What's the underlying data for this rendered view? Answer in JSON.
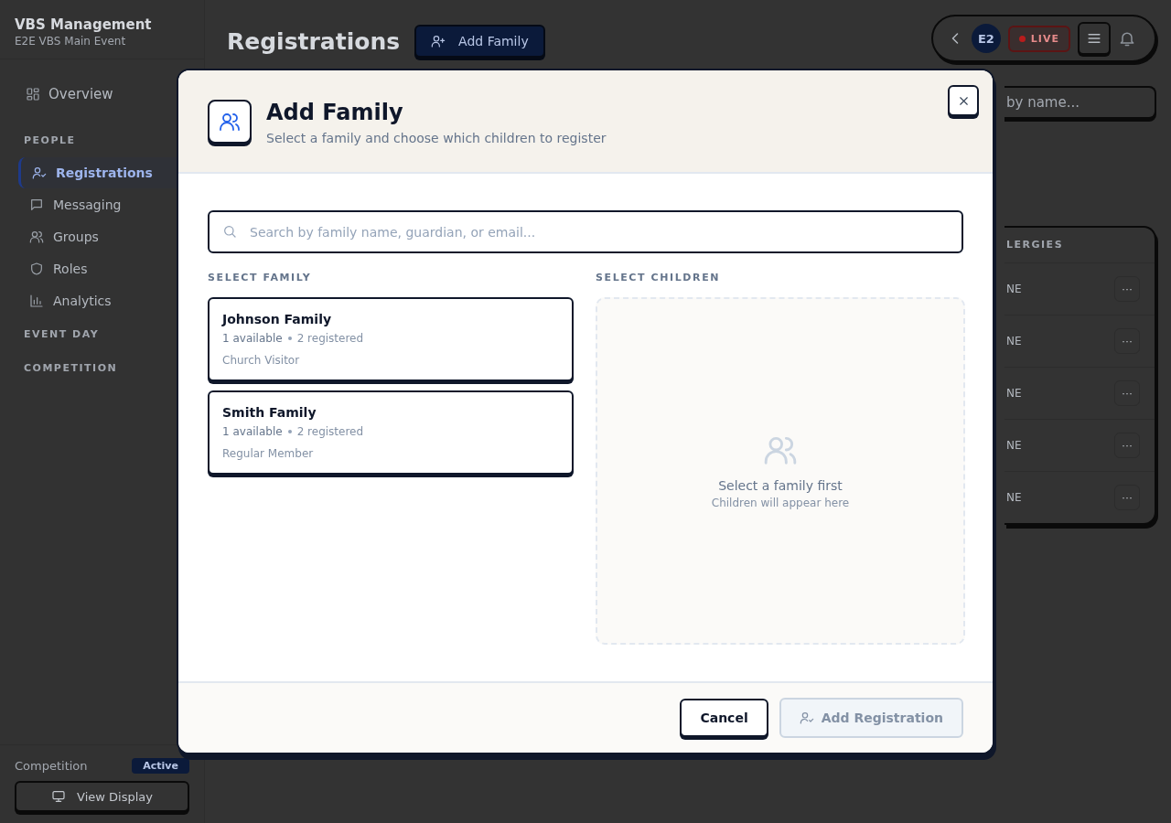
{
  "sidebar": {
    "title": "VBS Management",
    "subtitle": "E2E VBS Main Event",
    "top_items": [
      {
        "label": "Overview",
        "selected": false
      }
    ],
    "sections": [
      {
        "label": "PEOPLE",
        "items": [
          {
            "label": "Registrations",
            "selected": true
          },
          {
            "label": "Messaging",
            "selected": false
          },
          {
            "label": "Groups",
            "selected": false
          },
          {
            "label": "Roles",
            "selected": false
          },
          {
            "label": "Analytics",
            "selected": false
          }
        ]
      },
      {
        "label": "EVENT DAY"
      },
      {
        "label": "COMPETITION"
      }
    ],
    "footer": {
      "label": "Competition",
      "badge": "Active",
      "button": "View Display"
    }
  },
  "header": {
    "title": "Registrations",
    "add_button": "Add Family",
    "avatar": "E2",
    "live_badge": "LIVE"
  },
  "search": {
    "placeholder": "by name..."
  },
  "table": {
    "column": "LERGIES",
    "rows": [
      {
        "cell": "NE",
        "menu": "···"
      },
      {
        "cell": "NE",
        "menu": "···"
      },
      {
        "cell": "NE",
        "menu": "···"
      },
      {
        "cell": "NE",
        "menu": "···"
      },
      {
        "cell": "NE",
        "menu": "···"
      }
    ]
  },
  "modal": {
    "title": "Add Family",
    "subtitle": "Select a family and choose which children to register",
    "search": {
      "placeholder": "Search by family name, guardian, or email..."
    },
    "family_heading": "SELECT FAMILY",
    "children_heading": "SELECT CHILDREN",
    "families": [
      {
        "name": "Johnson Family",
        "available": "1 available",
        "registered": "2 registered",
        "type": "Church Visitor",
        "selected": false
      },
      {
        "name": "Smith Family",
        "available": "1 available",
        "registered": "2 registered",
        "type": "Regular Member",
        "selected": false
      }
    ],
    "empty": {
      "title": "Select a family first",
      "hint": "Children will appear here"
    },
    "cancel": "Cancel",
    "submit": {
      "label": "Add Registration",
      "disabled": true
    }
  }
}
